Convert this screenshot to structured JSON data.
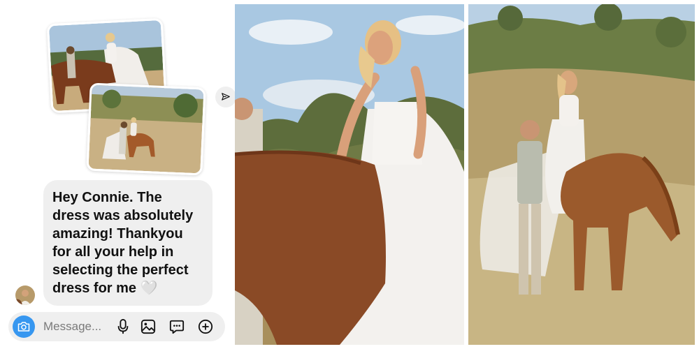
{
  "message": {
    "lines": [
      "Hey Connie. The",
      "dress was absolutely",
      "amazing! Thankyou",
      "for all your help in",
      "selecting the perfect",
      "dress for me"
    ],
    "heart": "🤍"
  },
  "composer": {
    "placeholder": "Message..."
  },
  "icons": [
    "send-icon",
    "camera-icon",
    "microphone-icon",
    "image-icon",
    "sticker-icon",
    "plus-icon"
  ],
  "colors": {
    "bubble": "#efefef",
    "camera_button": "#3797f0",
    "text": "#111111"
  }
}
